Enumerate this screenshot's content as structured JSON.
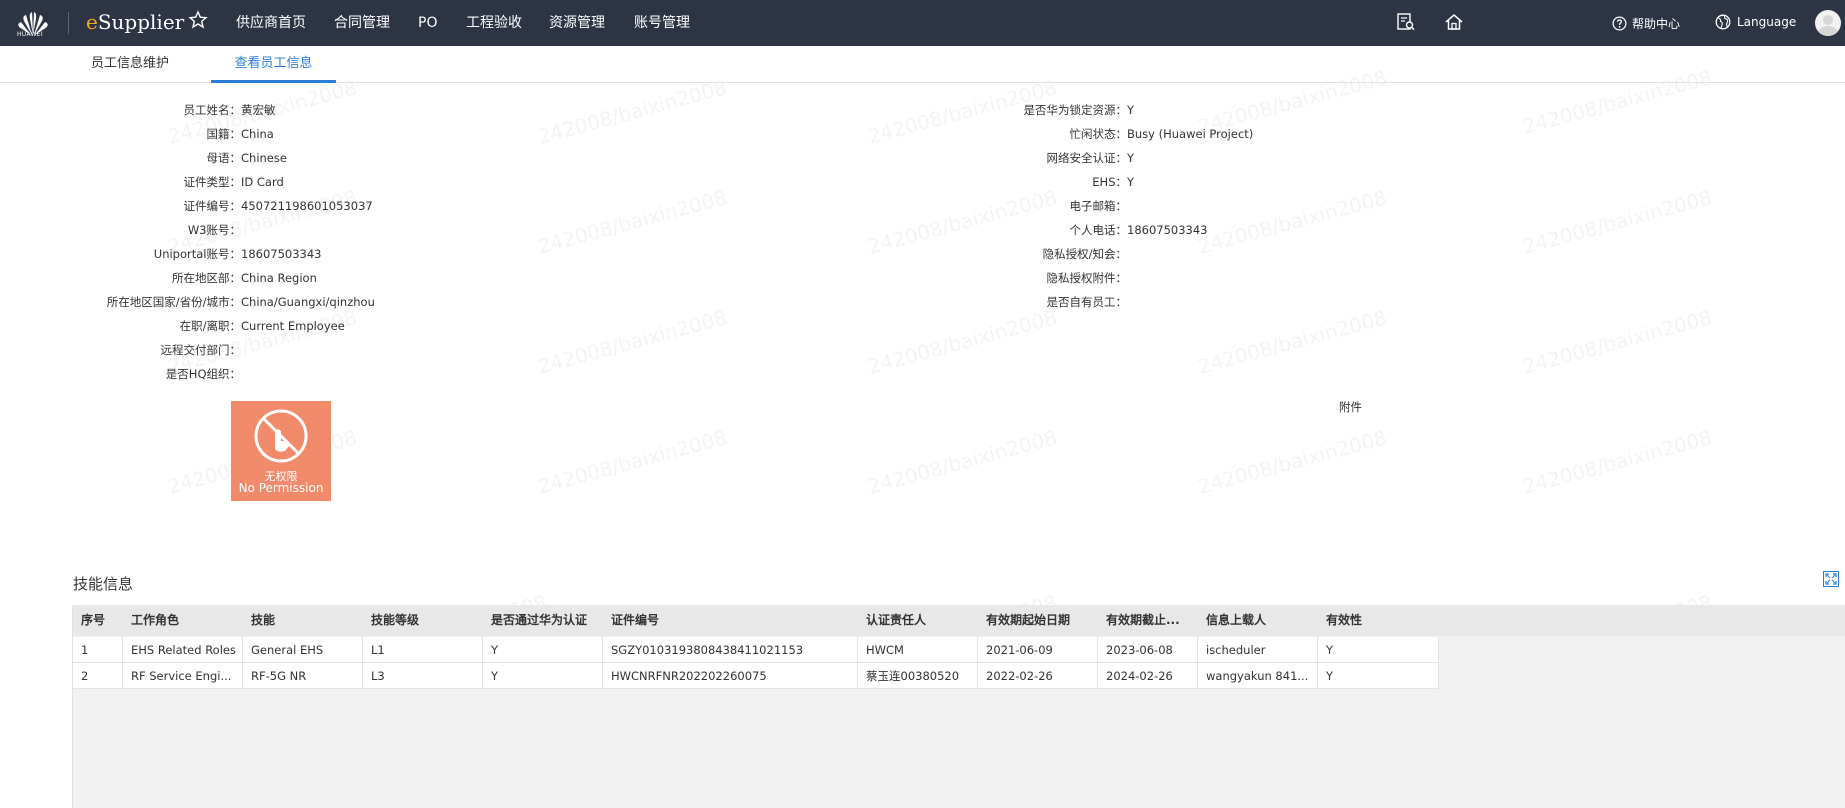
{
  "topbar": {
    "logo_text": "HUAWEI",
    "brand_prefix": "e",
    "brand_rest": "Supplier",
    "nav": [
      "供应商首页",
      "合同管理",
      "PO",
      "工程验收",
      "资源管理",
      "账号管理"
    ],
    "help_label": "帮助中心",
    "language_label": "Language"
  },
  "tabs": [
    "员工信息维护",
    "查看员工信息"
  ],
  "watermark": "242008/baixin2008",
  "left_info": [
    {
      "label": "员工姓名：",
      "value": "黄宏敏"
    },
    {
      "label": "国籍：",
      "value": "China"
    },
    {
      "label": "母语：",
      "value": "Chinese"
    },
    {
      "label": "证件类型：",
      "value": "ID Card"
    },
    {
      "label": "证件编号：",
      "value": "450721198601053037"
    },
    {
      "label": "W3账号：",
      "value": ""
    },
    {
      "label": "Uniportal账号：",
      "value": "18607503343"
    },
    {
      "label": "所在地区部：",
      "value": "China Region"
    },
    {
      "label": "所在地区国家/省份/城市：",
      "value": "China/Guangxi/qinzhou"
    },
    {
      "label": "在职/离职：",
      "value": "Current Employee"
    },
    {
      "label": "远程交付部门：",
      "value": ""
    },
    {
      "label": "是否HQ组织：",
      "value": ""
    }
  ],
  "right_info": [
    {
      "label": "是否华为锁定资源：",
      "value": "Y"
    },
    {
      "label": "忙闲状态：",
      "value": "Busy (Huawei Project)"
    },
    {
      "label": "网络安全认证：",
      "value": "Y"
    },
    {
      "label": "EHS：",
      "value": "Y"
    },
    {
      "label": "电子邮箱：",
      "value": ""
    },
    {
      "label": "个人电话：",
      "value": "18607503343"
    },
    {
      "label": "隐私授权/知会：",
      "value": ""
    },
    {
      "label": "隐私授权附件：",
      "value": ""
    },
    {
      "label": "是否自有员工：",
      "value": ""
    }
  ],
  "photo": {
    "line1": "无权限",
    "line2": "No Permission"
  },
  "attachment_label": "附件",
  "skills": {
    "title": "技能信息",
    "columns": [
      "序号",
      "工作角色",
      "技能",
      "技能等级",
      "是否通过华为认证",
      "证件编号",
      "认证责任人",
      "有效期起始日期",
      "有效期截止...",
      "信息上载人",
      "有效性"
    ],
    "rows": [
      [
        "1",
        "EHS Related Roles",
        "General EHS",
        "L1",
        "Y",
        "SGZY010319380843841102115​3",
        "HWCM",
        "2021-06-09",
        "2023-06-08",
        "ischeduler",
        "Y"
      ],
      [
        "2",
        "RF Service Engi...",
        "RF-5G NR",
        "L3",
        "Y",
        "HWCNRFNR202202260075",
        "蔡玉连00380520",
        "2022-02-26",
        "2024-02-26",
        "wangyakun 841...",
        "Y"
      ]
    ]
  },
  "colors": {
    "topbar": "#2d3443",
    "accent": "#2b7fd9",
    "brand_e": "#f5a623",
    "no_permission": "#f08a6a"
  }
}
